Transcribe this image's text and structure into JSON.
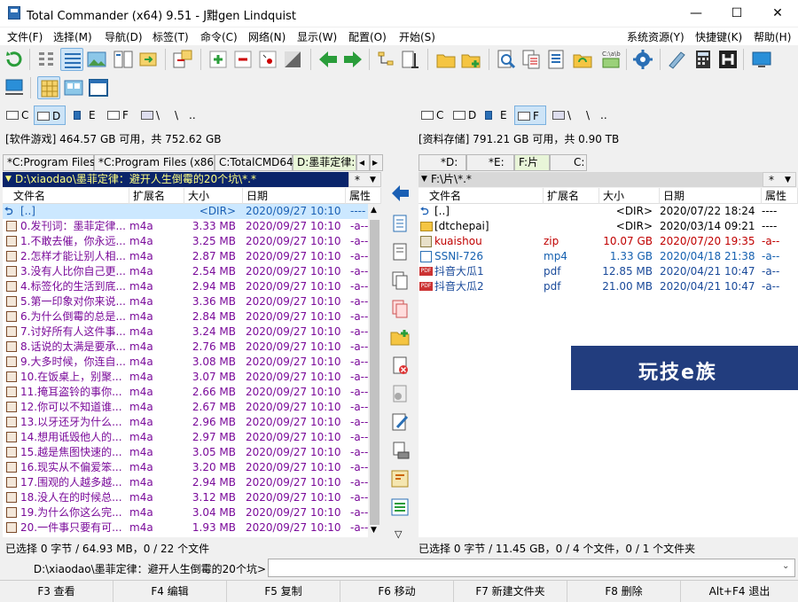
{
  "window": {
    "title": "Total Commander (x64) 9.51 - J黚gen Lindquist",
    "minimize": "—",
    "maximize": "☐",
    "close": "✕"
  },
  "menu": {
    "items": [
      "文件(F)",
      "选择(M)",
      "导航(D)",
      "标签(T)",
      "命令(C)",
      "网络(N)",
      "显示(W)",
      "配置(O)",
      "开始(S)"
    ],
    "right": [
      "系统资源(Y)",
      "快捷键(K)",
      "帮助(H)"
    ]
  },
  "toolbar_icons": [
    "refresh-icon",
    "brief-view-icon",
    "detail-view-icon",
    "thumbnail-view-icon",
    "tree-view-icon",
    "sync-dirs-icon",
    "pack-icon",
    "select-group-icon",
    "unselect-group-icon",
    "select-all-icon",
    "invert-selection-icon",
    "back-icon",
    "forward-icon",
    "compare-dirs-icon",
    "multi-rename-icon",
    "new-folder-icon",
    "new-folder-plus-icon",
    "search-icon",
    "copy-names-icon",
    "properties-icon",
    "sync-icon",
    "cd-path-icon",
    "settings-icon",
    "notepad-icon",
    "calculator-icon",
    "hex-icon",
    "screen-icon"
  ],
  "left": {
    "drives": [
      "C",
      "D",
      "E",
      "F",
      "\\",
      ".."
    ],
    "selected_drive": "D",
    "free": "[软件游戏]  464.57 GB 可用，共 752.62 GB",
    "tabs": [
      "*C:Program Files",
      "*C:Program Files (x86)",
      "C:TotalCMD64",
      "D:墨菲定律:"
    ],
    "path": "D:\\xiaodao\\墨菲定律：避开人生倒霉的20个坑\\*.*",
    "path_right": "*",
    "columns": [
      "文件名",
      "扩展名",
      "大小",
      "日期",
      "属性"
    ],
    "rows": [
      {
        "name": "[..]",
        "ext": "",
        "size": "<DIR>",
        "date": "2020/09/27 10:10",
        "attr": "----"
      },
      {
        "name": "0.发刊词：墨菲定律...",
        "ext": "m4a",
        "size": "3.33 MB",
        "date": "2020/09/27 10:10",
        "attr": "-a--"
      },
      {
        "name": "1.不敢去催，你永远...",
        "ext": "m4a",
        "size": "3.25 MB",
        "date": "2020/09/27 10:10",
        "attr": "-a--"
      },
      {
        "name": "2.怎样才能让别人相...",
        "ext": "m4a",
        "size": "2.87 MB",
        "date": "2020/09/27 10:10",
        "attr": "-a--"
      },
      {
        "name": "3.没有人比你自己更...",
        "ext": "m4a",
        "size": "2.54 MB",
        "date": "2020/09/27 10:10",
        "attr": "-a--"
      },
      {
        "name": "4.标签化的生活到底...",
        "ext": "m4a",
        "size": "2.94 MB",
        "date": "2020/09/27 10:10",
        "attr": "-a--"
      },
      {
        "name": "5.第一印象对你来说...",
        "ext": "m4a",
        "size": "3.36 MB",
        "date": "2020/09/27 10:10",
        "attr": "-a--"
      },
      {
        "name": "6.为什么倒霉的总是...",
        "ext": "m4a",
        "size": "2.84 MB",
        "date": "2020/09/27 10:10",
        "attr": "-a--"
      },
      {
        "name": "7.讨好所有人这件事...",
        "ext": "m4a",
        "size": "3.24 MB",
        "date": "2020/09/27 10:10",
        "attr": "-a--"
      },
      {
        "name": "8.话说的太满是要承...",
        "ext": "m4a",
        "size": "2.76 MB",
        "date": "2020/09/27 10:10",
        "attr": "-a--"
      },
      {
        "name": "9.大多时候，你连自...",
        "ext": "m4a",
        "size": "3.08 MB",
        "date": "2020/09/27 10:10",
        "attr": "-a--"
      },
      {
        "name": "10.在饭桌上，别聚...",
        "ext": "m4a",
        "size": "3.07 MB",
        "date": "2020/09/27 10:10",
        "attr": "-a--"
      },
      {
        "name": "11.掩耳盗铃的事你...",
        "ext": "m4a",
        "size": "2.66 MB",
        "date": "2020/09/27 10:10",
        "attr": "-a--"
      },
      {
        "name": "12.你可以不知道谁...",
        "ext": "m4a",
        "size": "2.67 MB",
        "date": "2020/09/27 10:10",
        "attr": "-a--"
      },
      {
        "name": "13.以牙还牙为什么...",
        "ext": "m4a",
        "size": "2.96 MB",
        "date": "2020/09/27 10:10",
        "attr": "-a--"
      },
      {
        "name": "14.想用诋毁他人的...",
        "ext": "m4a",
        "size": "2.97 MB",
        "date": "2020/09/27 10:10",
        "attr": "-a--"
      },
      {
        "name": "15.越是焦图快速的...",
        "ext": "m4a",
        "size": "3.05 MB",
        "date": "2020/09/27 10:10",
        "attr": "-a--"
      },
      {
        "name": "16.现实从不偏爱笨...",
        "ext": "m4a",
        "size": "3.20 MB",
        "date": "2020/09/27 10:10",
        "attr": "-a--"
      },
      {
        "name": "17.围观的人越多越...",
        "ext": "m4a",
        "size": "2.94 MB",
        "date": "2020/09/27 10:10",
        "attr": "-a--"
      },
      {
        "name": "18.没人在的时候总...",
        "ext": "m4a",
        "size": "3.12 MB",
        "date": "2020/09/27 10:10",
        "attr": "-a--"
      },
      {
        "name": "19.为什么你这么完...",
        "ext": "m4a",
        "size": "3.04 MB",
        "date": "2020/09/27 10:10",
        "attr": "-a--"
      },
      {
        "name": "20.一件事只要有可...",
        "ext": "m4a",
        "size": "1.93 MB",
        "date": "2020/09/27 10:10",
        "attr": "-a--"
      }
    ],
    "status": "已选择 0 字节 / 64.93 MB，0 / 22 个文件"
  },
  "right": {
    "drives": [
      "C",
      "D",
      "E",
      "F",
      "\\",
      ".."
    ],
    "selected_drive": "F",
    "free": "[资料存储]  791.21 GB 可用，共 0.90 TB",
    "tabs": [
      "*D:",
      "*E:",
      "F:片",
      "C:"
    ],
    "path": "F:\\片\\*.*",
    "path_right": "*",
    "columns": [
      "文件名",
      "扩展名",
      "大小",
      "日期",
      "属性"
    ],
    "rows": [
      {
        "name": "[..]",
        "ext": "",
        "size": "<DIR>",
        "date": "2020/07/22 18:24",
        "attr": "----",
        "kind": "up"
      },
      {
        "name": "[dtchepai]",
        "ext": "",
        "size": "<DIR>",
        "date": "2020/03/14 09:21",
        "attr": "----",
        "kind": "dir"
      },
      {
        "name": "kuaishou",
        "ext": "zip",
        "size": "10.07 GB",
        "date": "2020/07/20 19:35",
        "attr": "-a--",
        "kind": "zip"
      },
      {
        "name": "SSNI-726",
        "ext": "mp4",
        "size": "1.33 GB",
        "date": "2020/04/18 21:38",
        "attr": "-a--",
        "kind": "video"
      },
      {
        "name": "抖音大瓜1",
        "ext": "pdf",
        "size": "12.85 MB",
        "date": "2020/04/21 10:47",
        "attr": "-a--",
        "kind": "pdf"
      },
      {
        "name": "抖音大瓜2",
        "ext": "pdf",
        "size": "21.00 MB",
        "date": "2020/04/21 10:47",
        "attr": "-a--",
        "kind": "pdf"
      }
    ],
    "status": "已选择 0 字节 / 11.45 GB，0 / 4 个文件，0 / 1 个文件夹"
  },
  "cmdline": {
    "prompt": "D:\\xiaodao\\墨菲定律：避开人生倒霉的20个坑>",
    "value": ""
  },
  "fkeys": [
    "F3 查看",
    "F4 编辑",
    "F5 复制",
    "F6 移动",
    "F7 新建文件夹",
    "F8 删除",
    "Alt+F4 退出"
  ],
  "watermark": "玩技e族",
  "colors": {
    "accent": "#0a246a",
    "purple": "#7a0a9a",
    "dir": "#1a5fb4",
    "zip": "#c00000",
    "video": "#1560b0",
    "selrow": "#cce8ff",
    "header_bg": "#0a246a"
  }
}
